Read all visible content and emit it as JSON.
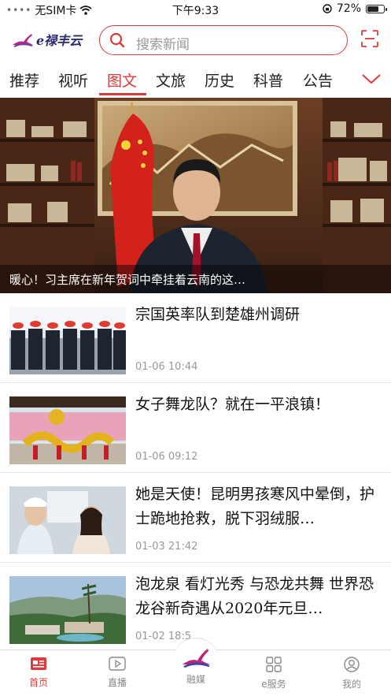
{
  "status_bar": {
    "carrier": "无SIM卡",
    "time": "下午9:33",
    "battery": "72%",
    "battery_level": 0.72
  },
  "header": {
    "brand": "e禄丰云",
    "search_placeholder": "搜索新闻"
  },
  "tabs": [
    {
      "label": "推荐"
    },
    {
      "label": "视听"
    },
    {
      "label": "图文",
      "active": true
    },
    {
      "label": "文旅"
    },
    {
      "label": "历史"
    },
    {
      "label": "科普"
    },
    {
      "label": "公告"
    }
  ],
  "banner": {
    "caption": "暖心！习主席在新年贺词中牵挂着云南的这…"
  },
  "news": [
    {
      "title": "宗国英率队到楚雄州调研",
      "time": "01-06 10:44"
    },
    {
      "title": "女子舞龙队？就在一平浪镇！",
      "time": "01-06 09:12"
    },
    {
      "title": "她是天使！昆明男孩寒风中晕倒，护士跪地抢救，脱下羽绒服…",
      "time": "01-03 21:42"
    },
    {
      "title": "泡龙泉 看灯光秀 与恐龙共舞 世界恐龙谷新奇遇从2020年元旦…",
      "time": "01-02 18:5"
    }
  ],
  "bottom_nav": [
    {
      "label": "首页",
      "icon": "news-icon",
      "active": true
    },
    {
      "label": "直播",
      "icon": "play-icon"
    },
    {
      "label": "融媒",
      "icon": "dino-logo-icon"
    },
    {
      "label": "e服务",
      "icon": "grid-icon"
    },
    {
      "label": "我的",
      "icon": "user-icon"
    }
  ],
  "colors": {
    "accent": "#d83c3c",
    "brand": "#2a2a6e"
  }
}
